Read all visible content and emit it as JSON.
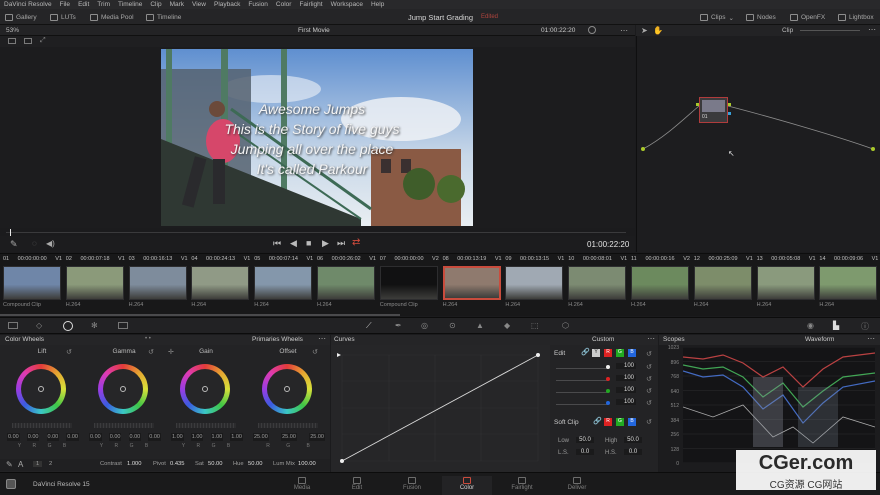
{
  "menubar": {
    "items": [
      "DaVinci Resolve",
      "File",
      "Edit",
      "Trim",
      "Timeline",
      "Clip",
      "Mark",
      "View",
      "Playback",
      "Fusion",
      "Color",
      "Fairlight",
      "Workspace",
      "Help"
    ]
  },
  "toolbar": {
    "gallery": "Gallery",
    "luts": "LUTs",
    "media_pool": "Media Pool",
    "timeline": "Timeline",
    "project_title": "Jump Start Grading",
    "project_status": "Edited",
    "clips": "Clips",
    "nodes": "Nodes",
    "openfx": "OpenFX",
    "lightbox": "Lightbox"
  },
  "viewer": {
    "zoom": "53%",
    "timeline_name": "First Movie",
    "timecode_top": "01:00:22:20",
    "timecode_bottom": "01:00:22:20",
    "subtitle_lines": [
      "Awesome Jumps",
      "This is the Story of five guys",
      "Jumping all over the place",
      "It's called Parkour"
    ]
  },
  "node_editor": {
    "mode": "Clip",
    "node_label": "01"
  },
  "clips": [
    {
      "num": "01",
      "tc": "00:00:00:00",
      "track": "V1",
      "codec": "Compound Clip",
      "color": "#6f86a8"
    },
    {
      "num": "02",
      "tc": "00:00:07:18",
      "track": "V1",
      "codec": "H.264",
      "color": "#8b9a7a"
    },
    {
      "num": "03",
      "tc": "00:00:16:13",
      "track": "V1",
      "codec": "H.264",
      "color": "#7e8c9c"
    },
    {
      "num": "04",
      "tc": "00:00:24:13",
      "track": "V1",
      "codec": "H.264",
      "color": "#909a86"
    },
    {
      "num": "05",
      "tc": "00:00:07:14",
      "track": "V1",
      "codec": "H.264",
      "color": "#8497ab"
    },
    {
      "num": "06",
      "tc": "00:00:26:02",
      "track": "V1",
      "codec": "H.264",
      "color": "#6f8a6a"
    },
    {
      "num": "07",
      "tc": "00:00:00:00",
      "track": "V2",
      "codec": "Compound Clip",
      "color": "#111112"
    },
    {
      "num": "08",
      "tc": "00:00:13:19",
      "track": "V1",
      "codec": "H.264",
      "color": "#8f7a6e"
    },
    {
      "num": "09",
      "tc": "00:00:13:15",
      "track": "V1",
      "codec": "H.264",
      "color": "#a0a9b3"
    },
    {
      "num": "10",
      "tc": "00:00:08:01",
      "track": "V1",
      "codec": "H.264",
      "color": "#7c8b72"
    },
    {
      "num": "11",
      "tc": "00:00:00:16",
      "track": "V2",
      "codec": "H.264",
      "color": "#6c8a5e"
    },
    {
      "num": "12",
      "tc": "00:00:25:09",
      "track": "V1",
      "codec": "H.264",
      "color": "#7d8d6a"
    },
    {
      "num": "13",
      "tc": "00:00:05:08",
      "track": "V1",
      "codec": "H.264",
      "color": "#8a9a7d"
    },
    {
      "num": "14",
      "tc": "00:00:09:06",
      "track": "V1",
      "codec": "H.264",
      "color": "#7e9a6e"
    }
  ],
  "color_wheels": {
    "title": "Color Wheels",
    "mode": "Primaries Wheels",
    "wheels": [
      {
        "name": "Lift",
        "values": [
          "0.00",
          "0.00",
          "0.00",
          "0.00"
        ]
      },
      {
        "name": "Gamma",
        "values": [
          "0.00",
          "0.00",
          "0.00",
          "0.00"
        ]
      },
      {
        "name": "Gain",
        "values": [
          "1.00",
          "1.00",
          "1.00",
          "1.00"
        ]
      },
      {
        "name": "Offset",
        "values": [
          "25.00",
          "25.00",
          "25.00"
        ]
      }
    ],
    "channels": [
      "Y",
      "R",
      "G",
      "B"
    ],
    "page_a": "1",
    "page_b": "2",
    "contrast_label": "Contrast",
    "contrast": "1.000",
    "pivot_label": "Pivot",
    "pivot": "0.435",
    "sat_label": "Sat",
    "sat": "50.00",
    "hue_label": "Hue",
    "hue": "50.00",
    "lummix_label": "Lum Mix",
    "lummix": "100.00"
  },
  "curves": {
    "title": "Curves",
    "mode": "Custom",
    "edit_label": "Edit",
    "edit_values": [
      "100",
      "100",
      "100",
      "100"
    ],
    "softclip_label": "Soft Clip",
    "low_label": "Low",
    "low": "50.0",
    "high_label": "High",
    "high": "50.0",
    "ls_label": "L.S.",
    "ls": "0.0",
    "hs_label": "H.S.",
    "hs": "0.0"
  },
  "scopes": {
    "title": "Scopes",
    "mode": "Waveform",
    "scale": [
      "1023",
      "896",
      "768",
      "640",
      "512",
      "384",
      "256",
      "128",
      "0"
    ]
  },
  "pagebar": {
    "app": "DaVinci Resolve 15",
    "pages": [
      "Media",
      "Edit",
      "Fusion",
      "Color",
      "Fairlight",
      "Deliver"
    ],
    "active": "Color"
  },
  "watermark": {
    "line1": "CGer.com",
    "line2": "CG资源 CG网站"
  }
}
